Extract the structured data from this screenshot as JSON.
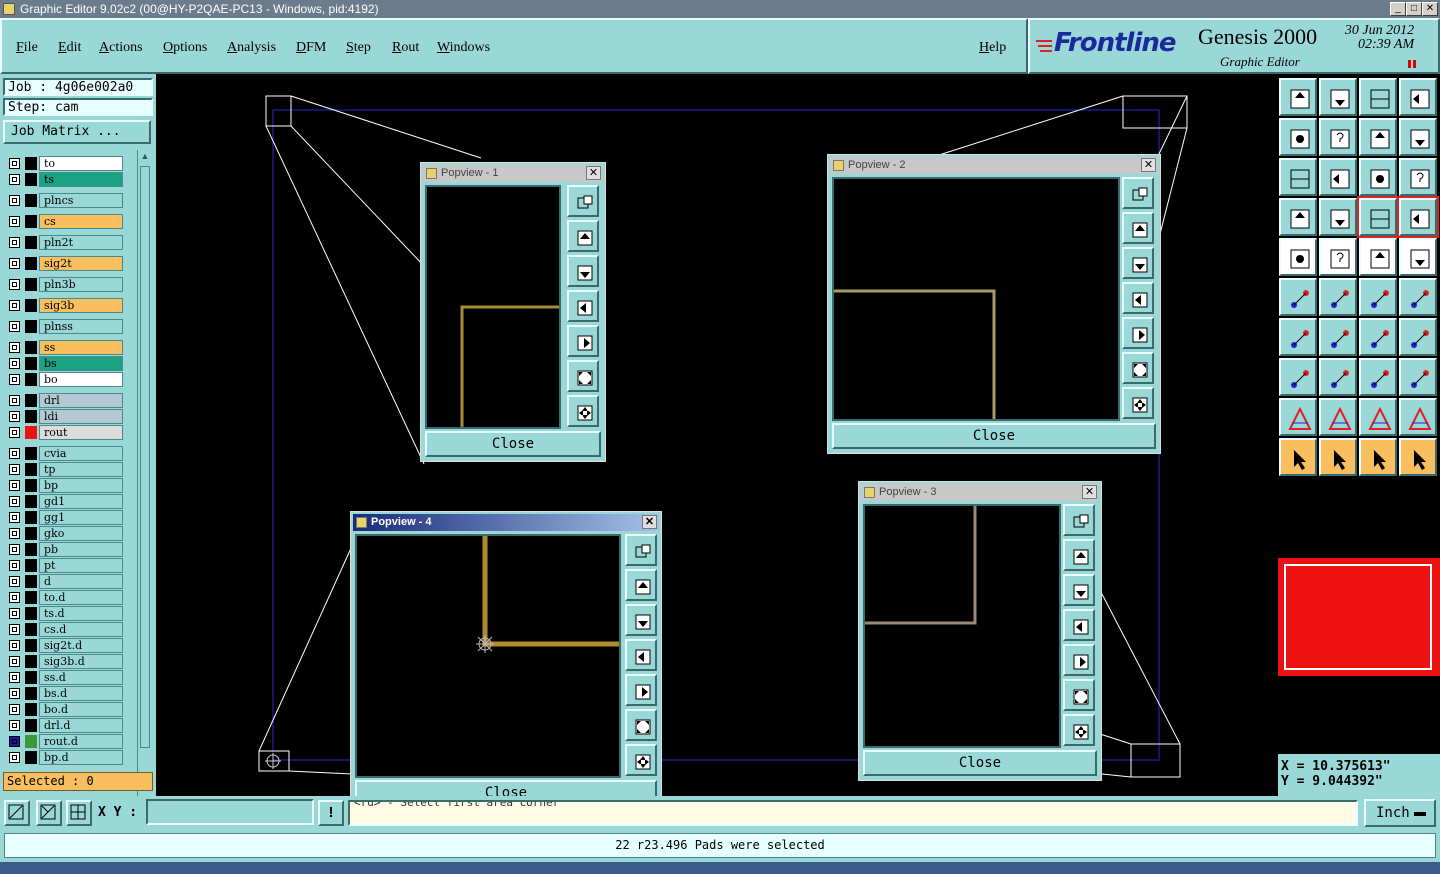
{
  "window": {
    "title": "Graphic Editor 9.02c2 (00@HY-P2QAE-PC13 - Windows, pid:4192)",
    "controls": [
      "_",
      "□",
      "✕"
    ]
  },
  "menu": {
    "items": [
      "File",
      "Edit",
      "Actions",
      "Options",
      "Analysis",
      "DFM",
      "Step",
      "Rout",
      "Windows"
    ],
    "help": "Help"
  },
  "brand": {
    "logo": "Frontline",
    "product": "Genesis 2000",
    "subtitle": "Graphic Editor",
    "date": "30 Jun 2012",
    "time": "02:39 AM"
  },
  "job": {
    "job_line": "Job : 4g06e002a0",
    "step_line": "Step: cam",
    "job_matrix": "Job Matrix ..."
  },
  "layers": [
    {
      "name": "to",
      "color": "#ffffff",
      "swatch": ""
    },
    {
      "name": "ts",
      "color": "#1aa383",
      "swatch": ""
    },
    {
      "name": "plncs",
      "color": "#9ad8d8",
      "swatch": ""
    },
    {
      "name": "cs",
      "color": "#f9bf5f",
      "swatch": ""
    },
    {
      "name": "pln2t",
      "color": "#9ad8d8",
      "swatch": ""
    },
    {
      "name": "sig2t",
      "color": "#f9bf5f",
      "swatch": ""
    },
    {
      "name": "pln3b",
      "color": "#9ad8d8",
      "swatch": ""
    },
    {
      "name": "sig3b",
      "color": "#f9bf5f",
      "swatch": ""
    },
    {
      "name": "plnss",
      "color": "#9ad8d8",
      "swatch": ""
    },
    {
      "name": "ss",
      "color": "#f9bf5f",
      "swatch": ""
    },
    {
      "name": "bs",
      "color": "#1aa383",
      "swatch": ""
    },
    {
      "name": "bo",
      "color": "#ffffff",
      "swatch": ""
    },
    {
      "name": "drl",
      "color": "#b4c8d4",
      "swatch": ""
    },
    {
      "name": "ldi",
      "color": "#b4c8d4",
      "swatch": ""
    },
    {
      "name": "rout",
      "color": "#dcdcdc",
      "swatch": "#ee1111"
    },
    {
      "name": "cvia",
      "color": "#9ad8d8",
      "swatch": ""
    },
    {
      "name": "tp",
      "color": "#9ad8d8",
      "swatch": ""
    },
    {
      "name": "bp",
      "color": "#9ad8d8",
      "swatch": ""
    },
    {
      "name": "gd1",
      "color": "#9ad8d8",
      "swatch": ""
    },
    {
      "name": "gg1",
      "color": "#9ad8d8",
      "swatch": ""
    },
    {
      "name": "gko",
      "color": "#9ad8d8",
      "swatch": ""
    },
    {
      "name": "pb",
      "color": "#9ad8d8",
      "swatch": ""
    },
    {
      "name": "pt",
      "color": "#9ad8d8",
      "swatch": ""
    },
    {
      "name": "d",
      "color": "#9ad8d8",
      "swatch": ""
    },
    {
      "name": "to.d",
      "color": "#9ad8d8",
      "swatch": ""
    },
    {
      "name": "ts.d",
      "color": "#9ad8d8",
      "swatch": ""
    },
    {
      "name": "cs.d",
      "color": "#9ad8d8",
      "swatch": ""
    },
    {
      "name": "sig2t.d",
      "color": "#9ad8d8",
      "swatch": ""
    },
    {
      "name": "sig3b.d",
      "color": "#9ad8d8",
      "swatch": ""
    },
    {
      "name": "ss.d",
      "color": "#9ad8d8",
      "swatch": ""
    },
    {
      "name": "bs.d",
      "color": "#9ad8d8",
      "swatch": ""
    },
    {
      "name": "bo.d",
      "color": "#9ad8d8",
      "swatch": ""
    },
    {
      "name": "drl.d",
      "color": "#9ad8d8",
      "swatch": ""
    },
    {
      "name": "rout.d",
      "color": "#9ad8d8",
      "swatch": "#3a9a3a"
    },
    {
      "name": "bp.d",
      "color": "#9ad8d8",
      "swatch": ""
    }
  ],
  "selected": "Selected : 0",
  "popviews": [
    {
      "title": "Popview - 1",
      "close": "Close",
      "x_glyph": "✕"
    },
    {
      "title": "Popview - 2",
      "close": "Close",
      "x_glyph": "✕"
    },
    {
      "title": "Popview - 3",
      "close": "Close",
      "x_glyph": "✕"
    },
    {
      "title": "Popview - 4",
      "close": "Close",
      "x_glyph": "✕"
    }
  ],
  "coords": {
    "x": "X = 10.375613\"",
    "y": "Y = 9.044392\""
  },
  "bottom": {
    "xy_label": "X Y :",
    "xy_value": "",
    "excl": "!",
    "prompt": "<rd> - Select first area corner",
    "units": "Inch"
  },
  "status": "22 r23.496 Pads were selected",
  "colors": {
    "panel": "#9ad8d8",
    "canvas": "#000000",
    "board_outline": "#2222cc",
    "trace": "#b08a30",
    "overview": "#ee1111"
  }
}
